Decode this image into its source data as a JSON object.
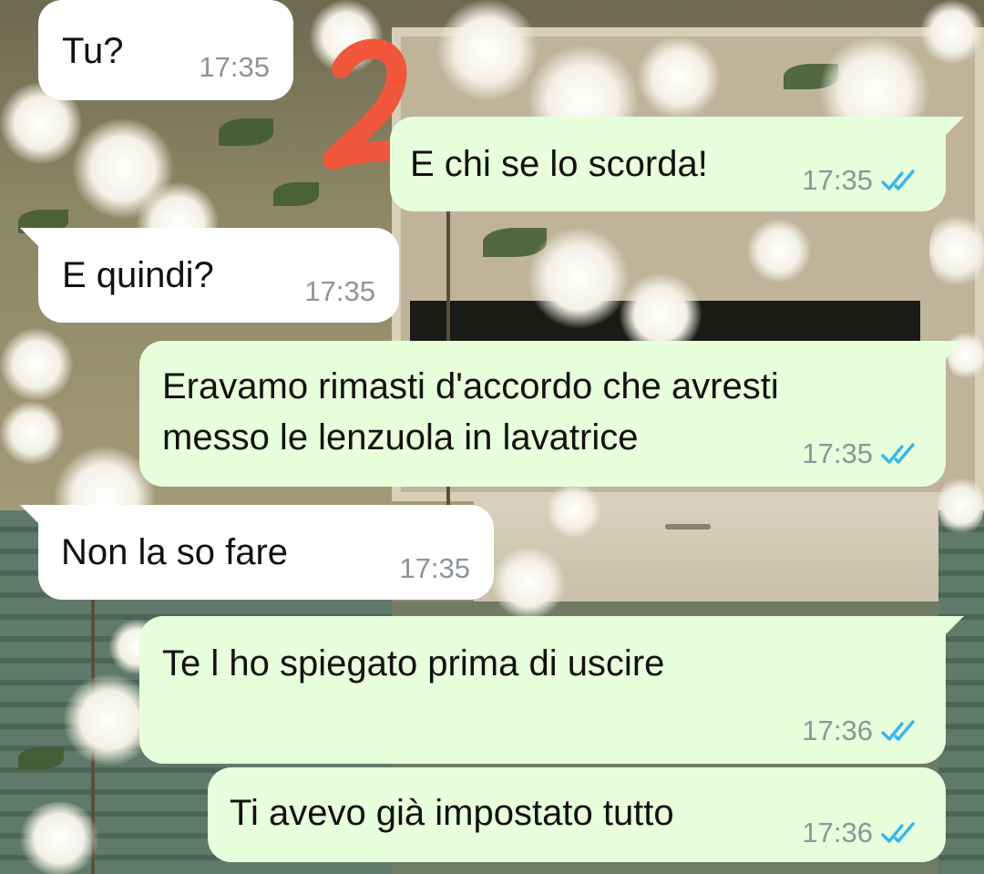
{
  "chat": {
    "messages": [
      {
        "id": "m1",
        "direction": "in",
        "text": "Tu?",
        "time": "17:35"
      },
      {
        "id": "m2",
        "direction": "out",
        "text": "E chi se lo scorda!",
        "time": "17:35",
        "status": "read"
      },
      {
        "id": "m3",
        "direction": "in",
        "text": "E quindi?",
        "time": "17:35"
      },
      {
        "id": "m4",
        "direction": "out",
        "lines": [
          "Eravamo rimasti d'accordo che avresti",
          "messo le lenzuola in lavatrice"
        ],
        "time": "17:35",
        "status": "read"
      },
      {
        "id": "m5",
        "direction": "in",
        "text": "Non la so fare",
        "time": "17:35"
      },
      {
        "id": "m6",
        "direction": "out",
        "text": "Te l ho spiegato prima di uscire",
        "time": "17:36",
        "status": "read"
      },
      {
        "id": "m7",
        "direction": "out",
        "text": "Ti avevo già impostato tutto",
        "time": "17:36",
        "status": "read"
      }
    ]
  },
  "annotation": {
    "text": "2",
    "color": "#f0573a"
  },
  "icons": {
    "read_receipt": "double-check-icon"
  },
  "colors": {
    "incoming_bubble": "#ffffff",
    "outgoing_bubble": "#e7ffdb",
    "timestamp": "#8d9499",
    "read_tick": "#34b7f1"
  }
}
